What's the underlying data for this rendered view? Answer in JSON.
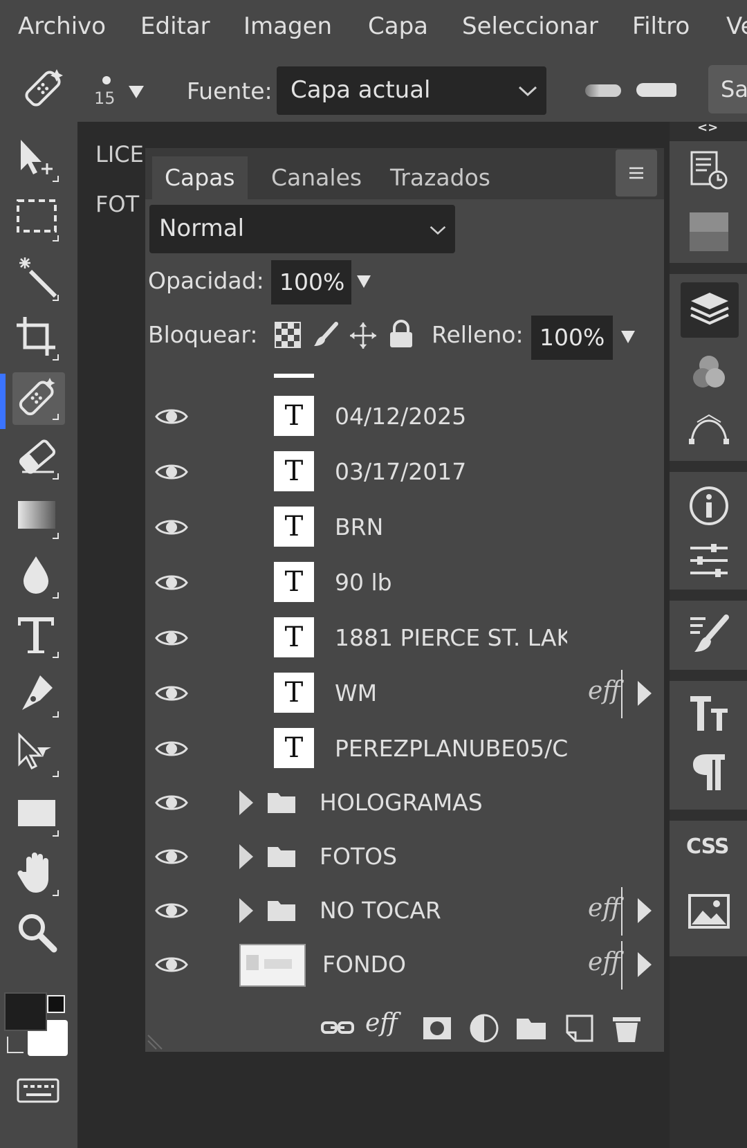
{
  "menu": {
    "items": [
      "Archivo",
      "Editar",
      "Imagen",
      "Capa",
      "Seleccionar",
      "Filtro",
      "Ve"
    ]
  },
  "options": {
    "brush_size": "15",
    "source_label": "Fuente:",
    "source_value": "Capa actual",
    "sample_button": "Sa"
  },
  "documents": {
    "labels": [
      "LICE",
      "FOT"
    ]
  },
  "layers_panel": {
    "tabs": [
      "Capas",
      "Canales",
      "Trazados"
    ],
    "blend_mode": "Normal",
    "opacity_label": "Opacidad:",
    "opacity_value": "100%",
    "lock_label": "Bloquear:",
    "fill_label": "Relleno:",
    "fill_value": "100%",
    "fx_label": "eff",
    "layers": [
      {
        "name": "04/12/2025",
        "kind": "text",
        "fx": false
      },
      {
        "name": "03/17/2017",
        "kind": "text",
        "fx": false
      },
      {
        "name": "BRN",
        "kind": "text",
        "fx": false
      },
      {
        "name": "90 lb",
        "kind": "text",
        "fx": false
      },
      {
        "name": "1881 PIERCE ST. LAK",
        "kind": "text",
        "fx": false
      },
      {
        "name": "WM",
        "kind": "text",
        "fx": true
      },
      {
        "name": "PEREZPLANUBE05/C",
        "kind": "text",
        "fx": false
      },
      {
        "name": "HOLOGRAMAS",
        "kind": "group",
        "fx": false
      },
      {
        "name": "FOTOS",
        "kind": "group",
        "fx": false
      },
      {
        "name": "NO TOCAR",
        "kind": "group",
        "fx": true
      },
      {
        "name": "FONDO",
        "kind": "image",
        "fx": true
      }
    ],
    "text_thumb_glyph": "T"
  },
  "right_dock": {
    "collapse_label": "<>",
    "css_label": "CSS"
  },
  "colors": {
    "ui_bg": "#474747",
    "dark_bg": "#2b2b2b",
    "accent": "#3b74ff",
    "foreground_swatch": "#1e1e1e",
    "background_swatch": "#ffffff"
  }
}
